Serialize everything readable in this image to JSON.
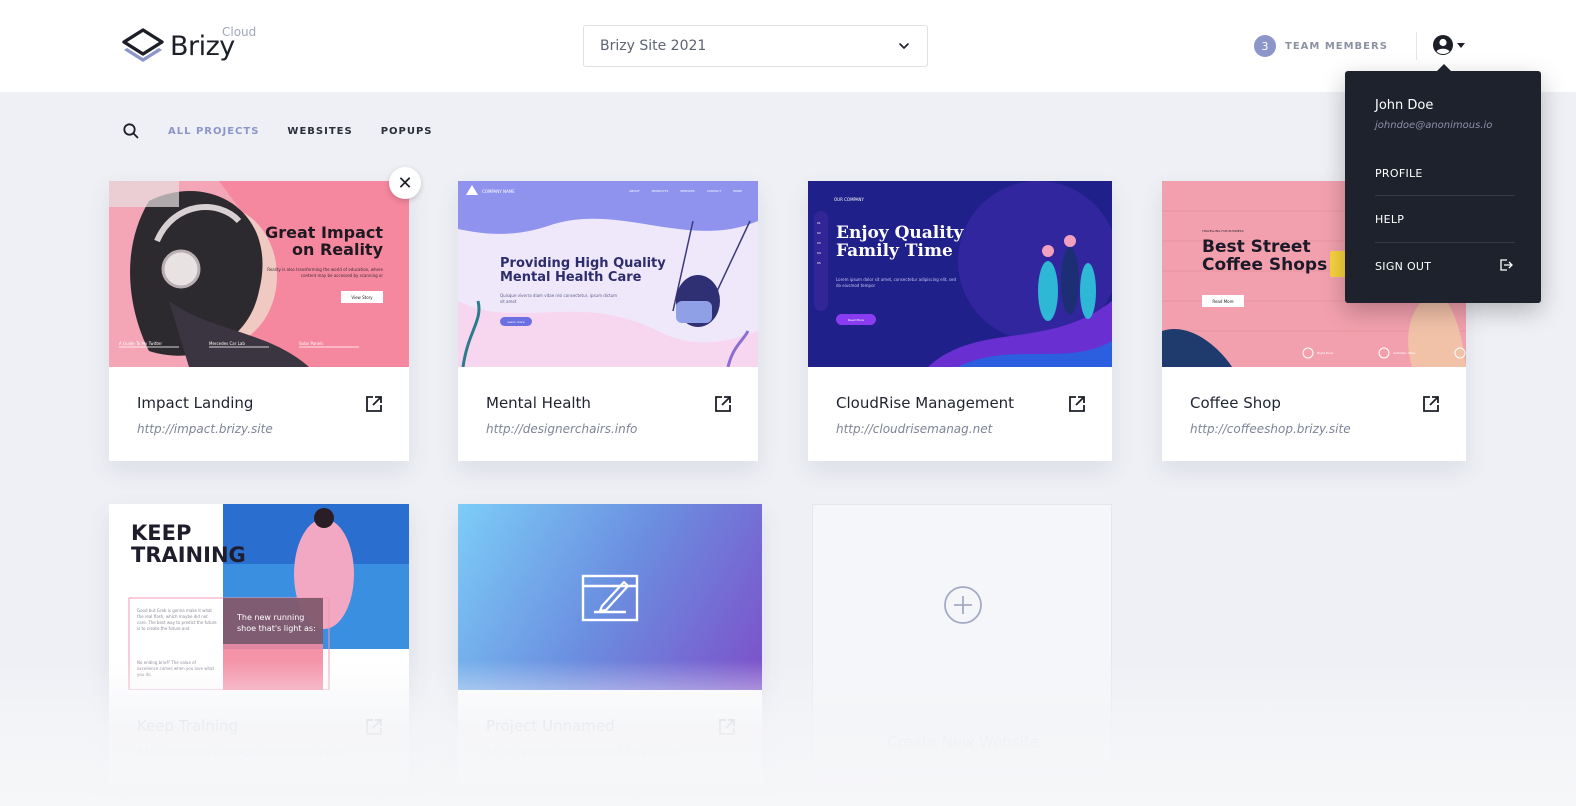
{
  "header": {
    "logo_text": "Brizy",
    "logo_sub": "Cloud",
    "site_select": "Brizy Site 2021",
    "team_count": "3",
    "team_label": "TEAM MEMBERS"
  },
  "filters": {
    "tabs": [
      "ALL PROJECTS",
      "WEBSITES",
      "POPUPS"
    ]
  },
  "projects": [
    {
      "title": "Impact Landing",
      "url": "http://impact.brizy.site",
      "thumb_heading": "Great Impact on Reality",
      "thumb_body": "Reality is also transforming the world of education, where content may be accessed by scanning or",
      "thumb_button": "View Story",
      "thumb_links": [
        "A Guide To My Twitter",
        "Mercedes Car Lab",
        "Solar Panels"
      ]
    },
    {
      "title": "Mental Health",
      "url": "http://designerchairs.info",
      "thumb_heading": "Providing High Quality Mental Health Care",
      "thumb_body": "Quisque viverra diam vitae nisi consectetur, ipsum dictum sit amet",
      "thumb_button": "Learn more",
      "thumb_brand": "COMPANY NAME",
      "thumb_nav": [
        "ABOUT",
        "PRODUCTS",
        "SERVICES",
        "CONTACT",
        "MORE"
      ]
    },
    {
      "title": "CloudRise Management",
      "url": "http://cloudrisemanag.net",
      "thumb_heading": "Enjoy Quality Family Time",
      "thumb_body": "Lorem ipsum dolor sit amet, consectetur adipiscing elit, sed do eiusmod tempor",
      "thumb_button": "Read More",
      "thumb_brand": "OUR COMPANY",
      "thumb_steps": [
        "01",
        "02",
        "03",
        "04",
        "05"
      ]
    },
    {
      "title": "Coffee Shop",
      "url": "http://coffeeshop.brizy.site",
      "thumb_kicker": "TRAVELLING FOR BUSINESS",
      "thumb_heading": "Best Street Coffee Shops",
      "thumb_button": "Read More",
      "thumb_items": [
        "Night Runs",
        "Aesthetic Sites",
        "Best"
      ]
    },
    {
      "title": "Keep Training",
      "url": "http://keeptrainingwithworkouts.io",
      "thumb_heading": "KEEP TRAINING",
      "thumb_tagline": "The new running shoe that's light as:",
      "thumb_text1": "Good but Grab is gonna make it what the real flash, which maybe did not care. The best way to predict the future is to create the future and",
      "thumb_text2": "No ending brief? The value of excellence comes when you love what you do."
    },
    {
      "title": "Project Unnamed",
      "url": "http://projectunnamed.brizy.site"
    }
  ],
  "create_new": "Create New Website",
  "dropdown": {
    "name": "John Doe",
    "email": "johndoe@anonimous.io",
    "items": [
      "PROFILE",
      "HELP",
      "SIGN OUT"
    ]
  },
  "colors": {
    "accent": "#8d96c9",
    "dropdown_bg": "#1e222d",
    "page_bg": "#eef0f5"
  }
}
